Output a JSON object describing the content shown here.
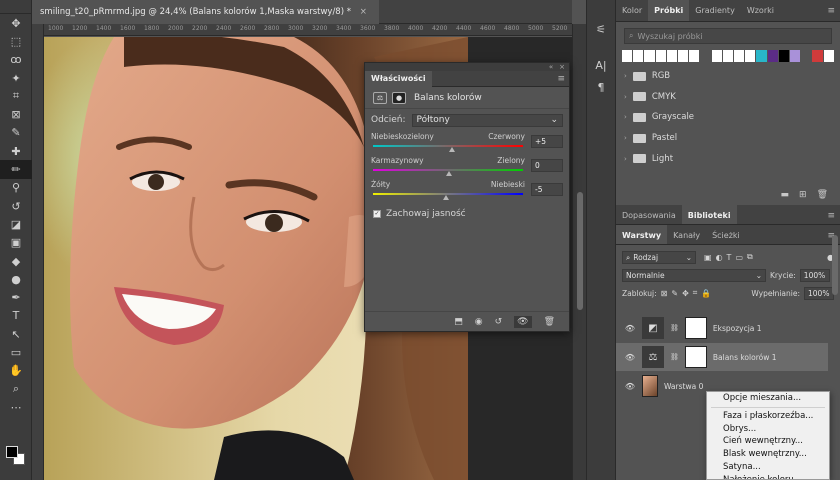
{
  "document": {
    "tab_title": "smiling_t20_pRmrmd.jpg @ 24,4% (Balans kolorów 1,Maska warstwy/8) *",
    "close": "×",
    "ruler_ticks": [
      "1000",
      "1200",
      "1400",
      "1600",
      "1800",
      "2000",
      "2200",
      "2400",
      "2600",
      "2800",
      "3000",
      "3200",
      "3400",
      "3600",
      "3800",
      "4000",
      "4200",
      "4400",
      "4600",
      "4800",
      "5000",
      "5200"
    ]
  },
  "toolbar": {
    "tools": [
      "move-tool",
      "marquee-tool",
      "lasso-tool",
      "magic-wand-tool",
      "crop-tool",
      "frame-tool",
      "eyedropper-tool",
      "healing-tool",
      "brush-tool",
      "clone-stamp-tool",
      "history-brush-tool",
      "eraser-tool",
      "gradient-tool",
      "blur-tool",
      "dodge-tool",
      "pen-tool",
      "type-tool",
      "path-select-tool",
      "shape-tool",
      "hand-tool",
      "zoom-tool",
      "more-tools"
    ],
    "glyphs": [
      "✥",
      "⬚",
      "ꝏ",
      "✦",
      "⌗",
      "⊠",
      "✎",
      "✚",
      "✏",
      "⚲",
      "↺",
      "◪",
      "▣",
      "◆",
      "●",
      "✒",
      "T",
      "↖",
      "▭",
      "✋",
      "⌕",
      "⋯"
    ],
    "foreground_color": "#000000",
    "background_color": "#ffffff"
  },
  "properties": {
    "title": "Właściwości",
    "subtitle": "Balans kolorów",
    "tone_label": "Odcień:",
    "tone_value": "Półtony",
    "sliders": [
      {
        "left": "Niebieskozielony",
        "right": "Czerwony",
        "value": "+5",
        "fraction": 0.52,
        "gradient": "linear-gradient(90deg,#00c8c8,#ff0000)"
      },
      {
        "left": "Karmazynowy",
        "right": "Zielony",
        "value": "0",
        "fraction": 0.5,
        "gradient": "linear-gradient(90deg,#e000e0,#00d000)"
      },
      {
        "left": "Żółty",
        "right": "Niebieski",
        "value": "-5",
        "fraction": 0.48,
        "gradient": "linear-gradient(90deg,#f0f000,#0000ff)"
      }
    ],
    "preserve_label": "Zachowaj jasność",
    "preserve_checked": true
  },
  "dock": {
    "icons": [
      "adjustments-icon",
      "character-icon",
      "paragraph-icon"
    ],
    "glyphs": [
      "⚟",
      "A|",
      "¶"
    ]
  },
  "swatches_panel": {
    "tabs": [
      "Kolor",
      "Próbki",
      "Gradienty",
      "Wzorki"
    ],
    "selected_tab": "Próbki",
    "search_placeholder": "Wyszukaj próbki",
    "recent_colors": [
      "#ffffff",
      "#ffffff",
      "#ffffff",
      "#ffffff",
      "#ffffff",
      "#ffffff",
      "#ffffff",
      "#535353",
      "#ffffff",
      "#ffffff",
      "#ffffff",
      "#ffffff",
      "#29b6c9",
      "#5b2c86",
      "#000000",
      "#a991d9",
      "#535353",
      "#d03b3b",
      "#ffffff"
    ],
    "folders": [
      "RGB",
      "CMYK",
      "Grayscale",
      "Pastel",
      "Light"
    ]
  },
  "layers_panel": {
    "top_tabs": [
      "Dopasowania",
      "Biblioteki"
    ],
    "tabs": [
      "Warstwy",
      "Kanały",
      "Ścieżki"
    ],
    "filter_label": "Rodzaj",
    "blend_mode": "Normalnie",
    "opacity_label": "Krycie:",
    "opacity_value": "100%",
    "lock_label": "Zablokuj:",
    "fill_label": "Wypełnianie:",
    "fill_value": "100%",
    "layers": [
      {
        "name": "Ekspozycja 1",
        "selected": false
      },
      {
        "name": "Balans kolorów 1",
        "selected": true
      },
      {
        "name": "Warstwa 0",
        "selected": false
      }
    ]
  },
  "context_menu": {
    "items": [
      "Opcje mieszania...",
      "Faza i płaskorzeźba...",
      "Obrys...",
      "Cień wewnętrzny...",
      "Blask wewnętrzny...",
      "Satyna...",
      "Nałożenie koloru..."
    ]
  }
}
